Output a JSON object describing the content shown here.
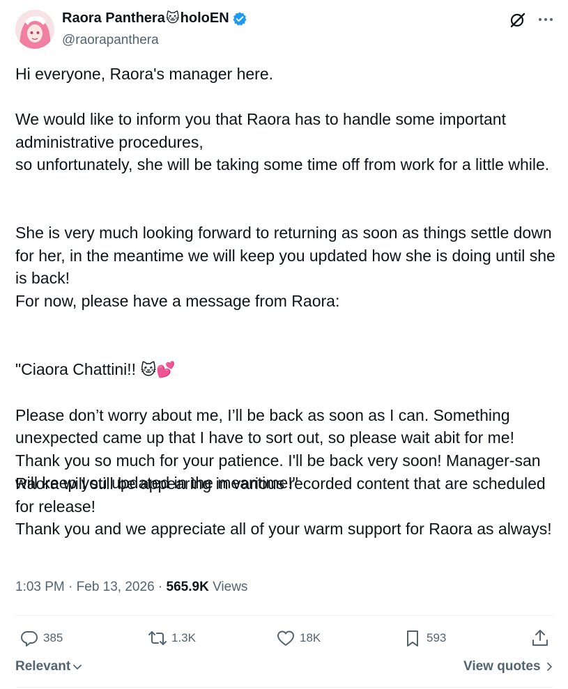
{
  "author": {
    "name_part1": "Raora Panthera",
    "name_emoji": "🐱",
    "name_part2": "holoEN",
    "handle": "@raorapanthera"
  },
  "tweet": {
    "p1": "Hi everyone, Raora's manager here.",
    "p2": "We would like to inform you that Raora has to handle some important administrative procedures,\nso unfortunately, she will be taking some time off from work for a little while.",
    "p3": "She is very much looking forward to returning as soon as things settle down for her, in the meantime we will keep you updated how she is doing until she is back!\nFor now, please have a message from Raora:",
    "p4_open": "\"Ciaora Chattini!! ",
    "p4_emoji": "🐱💕",
    "p4_rest": "Please don’t worry about me, I’ll be back as soon as I can. Something unexpected came up that I have to sort out, so please wait abit for me! Thank you so much for your patience. I'll be back very soon! Manager-san will keep you updated in the meantime!\"",
    "p5": "Raora will still be appearing in various recorded content that are scheduled for release!\nThank you and we appreciate all of your warm support for Raora as always!"
  },
  "meta": {
    "time": "1:03 PM",
    "sep1": " · ",
    "date": "Feb 13, 2026",
    "sep2": " · ",
    "views_count": "565.9K",
    "views_label": " Views"
  },
  "actions": {
    "replies": "385",
    "reposts": "1.3K",
    "likes": "18K",
    "bookmarks": "593"
  },
  "footer": {
    "sort_label": "Relevant",
    "view_quotes": "View quotes"
  },
  "colors": {
    "text": "#0f1419",
    "secondary": "#536471",
    "verified": "#1d9bf0"
  },
  "icons": [
    "grok-icon",
    "more-icon",
    "verified-icon",
    "reply-icon",
    "repost-icon",
    "like-icon",
    "bookmark-icon",
    "share-icon",
    "chevron-down-icon",
    "chevron-right-icon"
  ]
}
